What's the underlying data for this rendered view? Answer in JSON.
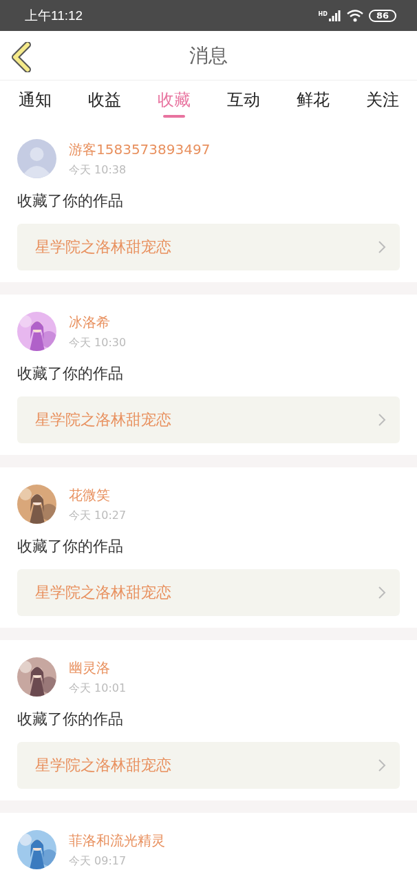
{
  "status_bar": {
    "time": "上午11:12",
    "network": "HD",
    "battery": "86"
  },
  "header": {
    "title": "消息"
  },
  "tabs": [
    {
      "label": "通知",
      "selected": false
    },
    {
      "label": "收益",
      "selected": false
    },
    {
      "label": "收藏",
      "selected": true
    },
    {
      "label": "互动",
      "selected": false
    },
    {
      "label": "鲜花",
      "selected": false
    },
    {
      "label": "关注",
      "selected": false
    }
  ],
  "messages": [
    {
      "avatar": {
        "kind": "default"
      },
      "name": "游客1583573893497",
      "time": "今天 10:38",
      "action": "收藏了你的作品",
      "work": "星学院之洛林甜宠恋"
    },
    {
      "name": "冰洛希",
      "time": "今天 10:30",
      "action": "收藏了你的作品",
      "work": "星学院之洛林甜宠恋"
    },
    {
      "name": "花微笑",
      "time": "今天 10:27",
      "action": "收藏了你的作品",
      "work": "星学院之洛林甜宠恋"
    },
    {
      "name": "幽灵洛",
      "time": "今天 10:01",
      "action": "收藏了你的作品",
      "work": "星学院之洛林甜宠恋"
    },
    {
      "name": "菲洛和流光精灵",
      "time": "今天 09:17"
    }
  ]
}
